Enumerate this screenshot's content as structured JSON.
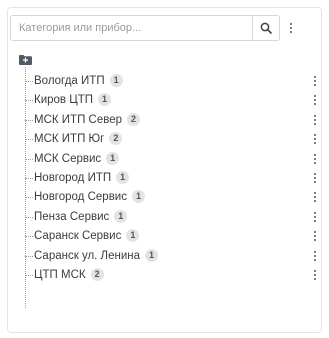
{
  "search": {
    "placeholder": "Категория или прибор...",
    "value": ""
  },
  "icons": {
    "search_button": "search-icon",
    "menu_button": "kebab-menu-icon",
    "root": "folder-icon"
  },
  "tree": {
    "items": [
      {
        "label": "Вологда ИТП",
        "count": "1"
      },
      {
        "label": "Киров ЦТП",
        "count": "1"
      },
      {
        "label": "МСК ИТП Север",
        "count": "2"
      },
      {
        "label": "МСК ИТП Юг",
        "count": "2"
      },
      {
        "label": "МСК Сервис",
        "count": "1"
      },
      {
        "label": "Новгород ИТП",
        "count": "1"
      },
      {
        "label": "Новгород Сервис",
        "count": "1"
      },
      {
        "label": "Пенза Сервис",
        "count": "1"
      },
      {
        "label": "Саранск Сервис",
        "count": "1"
      },
      {
        "label": "Саранск ул. Ленина",
        "count": "1"
      },
      {
        "label": "ЦТП МСК",
        "count": "2"
      }
    ]
  }
}
